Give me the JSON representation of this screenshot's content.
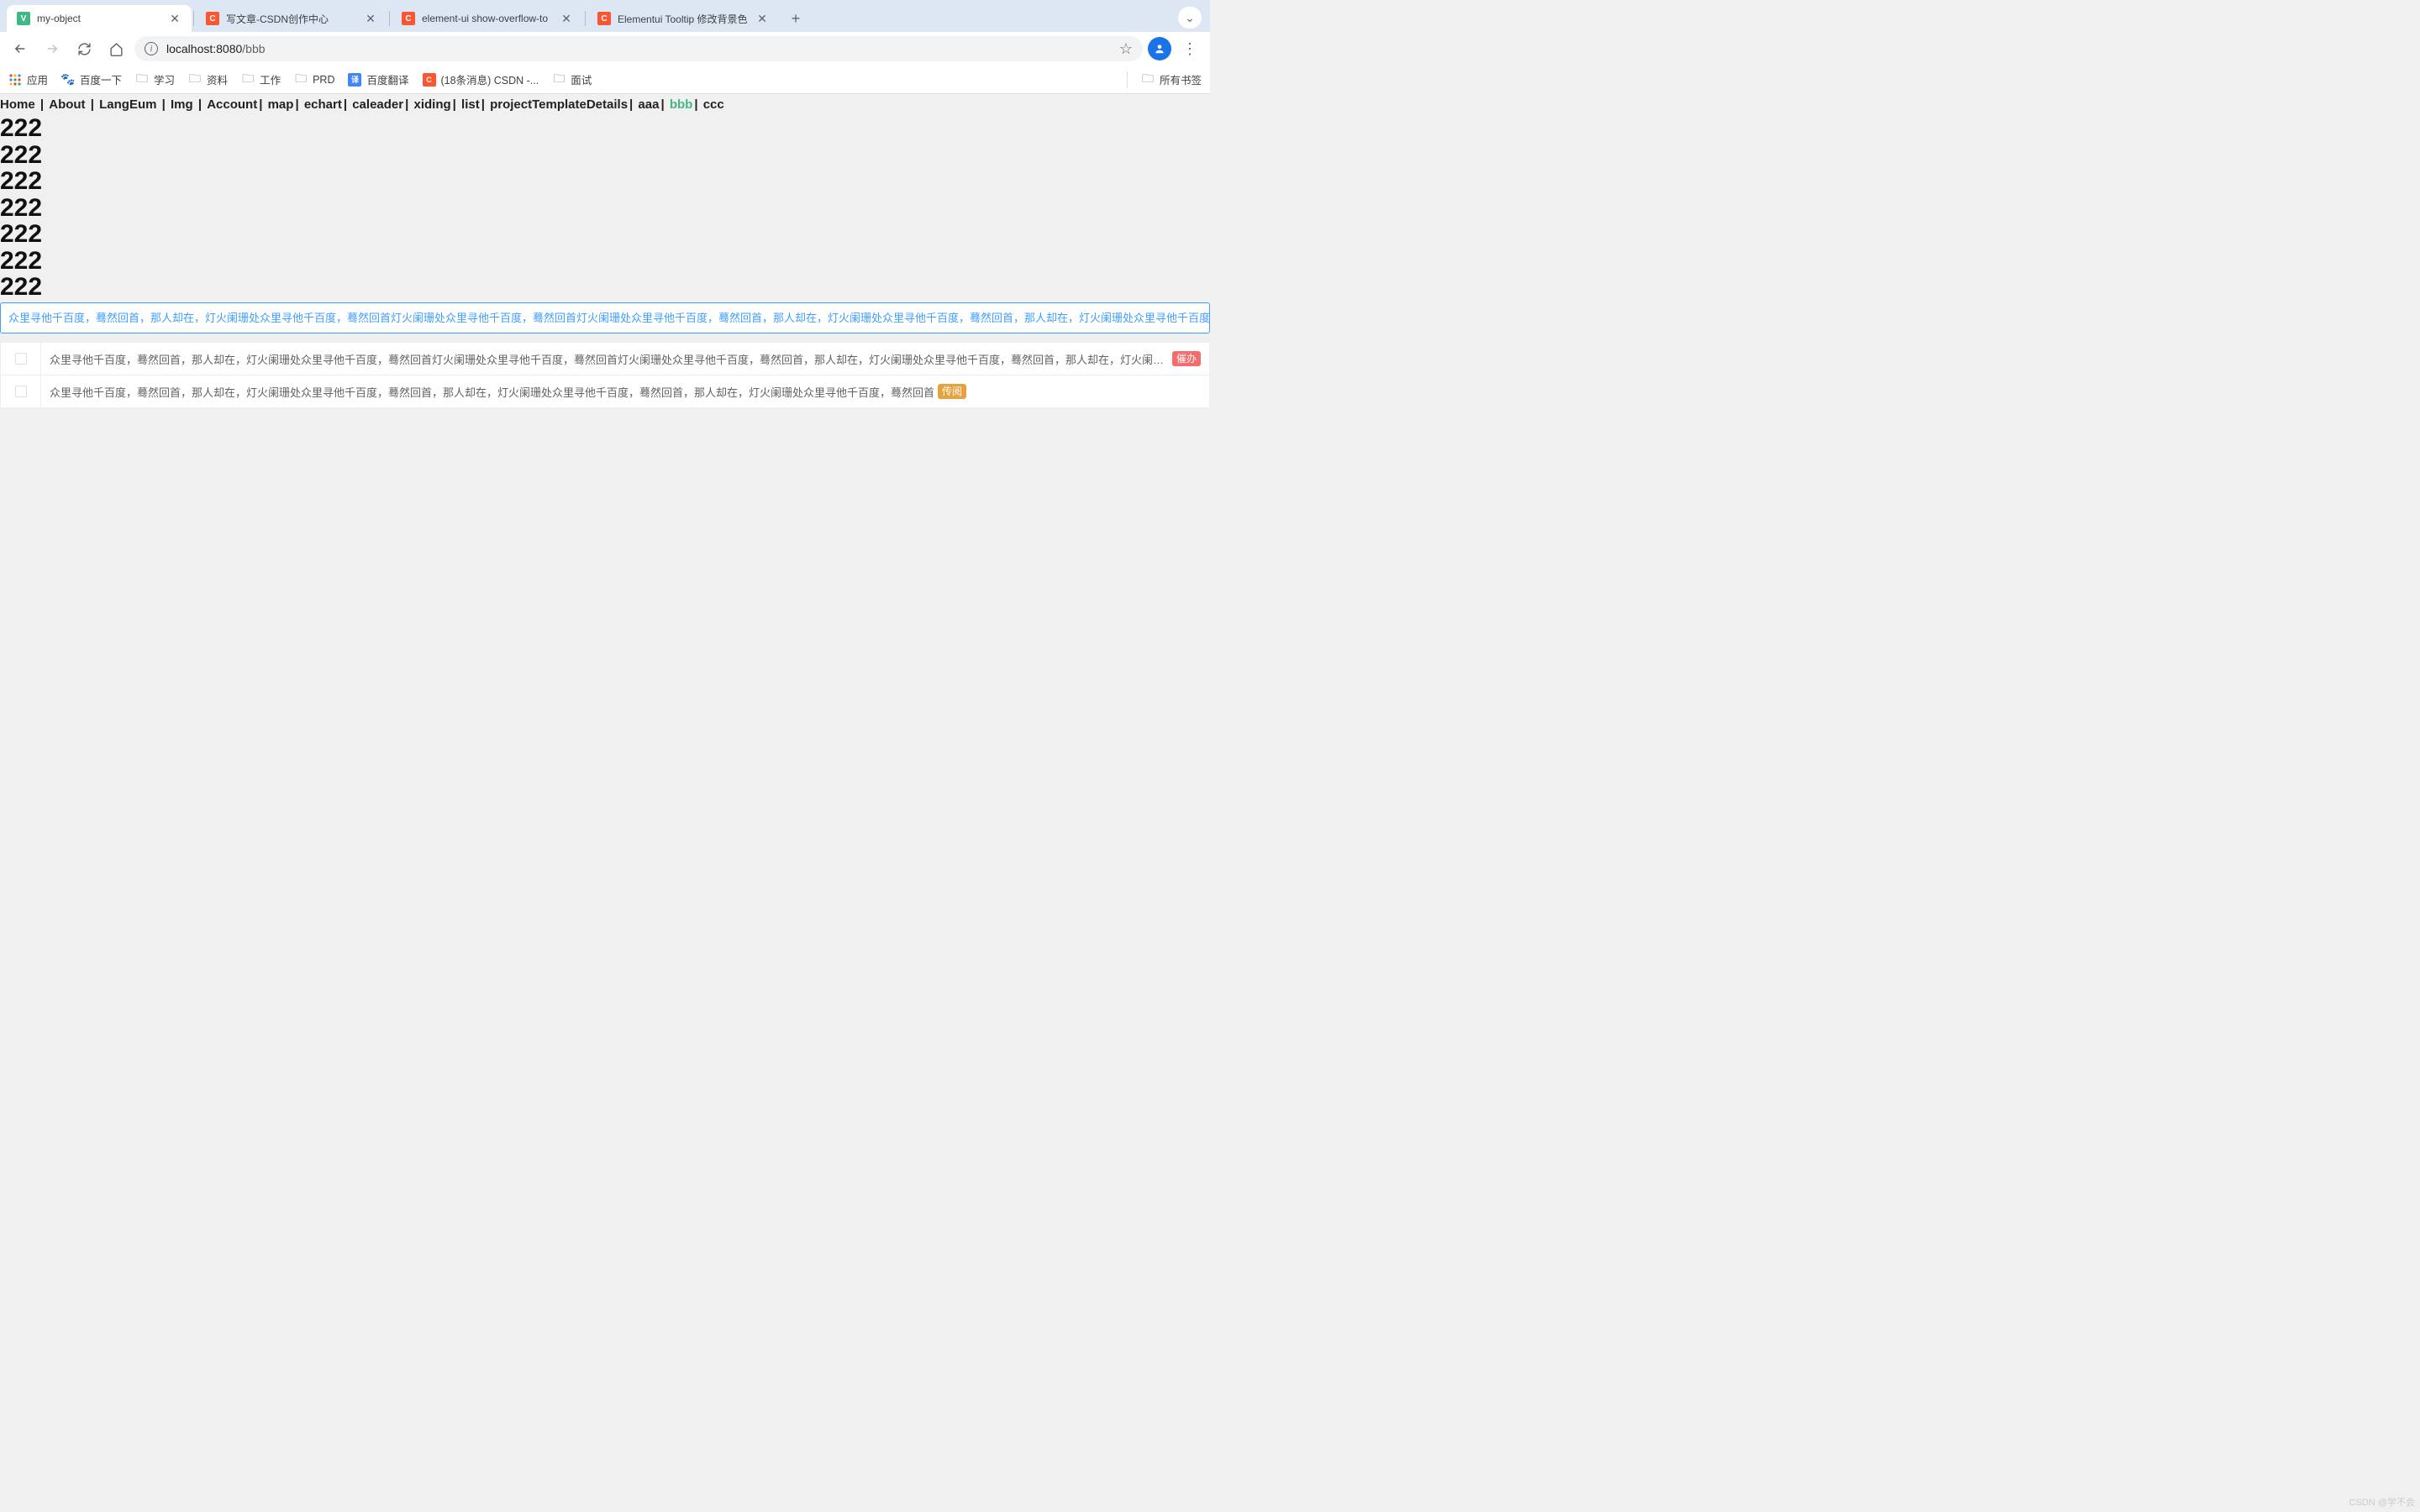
{
  "browser": {
    "tabs": [
      {
        "title": "my-object",
        "favicon": "vue",
        "active": true
      },
      {
        "title": "写文章-CSDN创作中心",
        "favicon": "csdn",
        "active": false
      },
      {
        "title": "element-ui show-overflow-to",
        "favicon": "csdn",
        "active": false
      },
      {
        "title": "Elementui Tooltip 修改背景色",
        "favicon": "csdn",
        "active": false
      }
    ],
    "url_host": "localhost:8080",
    "url_path": "/bbb",
    "bookmarks": {
      "apps": "应用",
      "items": [
        {
          "icon": "baidu",
          "label": "百度一下"
        },
        {
          "icon": "folder",
          "label": "学习"
        },
        {
          "icon": "folder",
          "label": "资料"
        },
        {
          "icon": "folder",
          "label": "工作"
        },
        {
          "icon": "folder",
          "label": "PRD"
        },
        {
          "icon": "translate",
          "label": "百度翻译"
        },
        {
          "icon": "csdn",
          "label": "(18条消息) CSDN -..."
        },
        {
          "icon": "folder",
          "label": "面试"
        }
      ],
      "all_bookmarks": "所有书签"
    }
  },
  "nav": {
    "items": [
      "Home",
      "About",
      "LangEum",
      "Img",
      "Account",
      "map",
      "echart",
      "caleader",
      "xiding",
      "list",
      "projectTemplateDetails",
      "aaa",
      "bbb",
      "ccc"
    ],
    "active": "bbb"
  },
  "repeated_number": "222",
  "tooltip": {
    "text": "众里寻他千百度，蓦然回首，那人却在，灯火阑珊处众里寻他千百度，蓦然回首灯火阑珊处众里寻他千百度，蓦然回首灯火阑珊处众里寻他千百度，蓦然回首，那人却在，灯火阑珊处众里寻他千百度，蓦然回首，那人却在，灯火阑珊处众里寻他千百度，蓦然回首",
    "badge": "催办"
  },
  "table": {
    "rows": [
      {
        "text": "众里寻他千百度，蓦然回首，那人却在，灯火阑珊处众里寻他千百度，蓦然回首灯火阑珊处众里寻他千百度，蓦然回首灯火阑珊处众里寻他千百度，蓦然回首，那人却在，灯火阑珊处众里寻他千百度，蓦然回首，那人却在，灯火阑珊处众里寻他千百...",
        "badge": "催办",
        "badge_color": "red"
      },
      {
        "text": "众里寻他千百度，蓦然回首，那人却在，灯火阑珊处众里寻他千百度，蓦然回首，那人却在，灯火阑珊处众里寻他千百度，蓦然回首，那人却在，灯火阑珊处众里寻他千百度，蓦然回首",
        "badge": "传阅",
        "badge_color": "orange"
      }
    ]
  },
  "watermark": "CSDN @学不会"
}
